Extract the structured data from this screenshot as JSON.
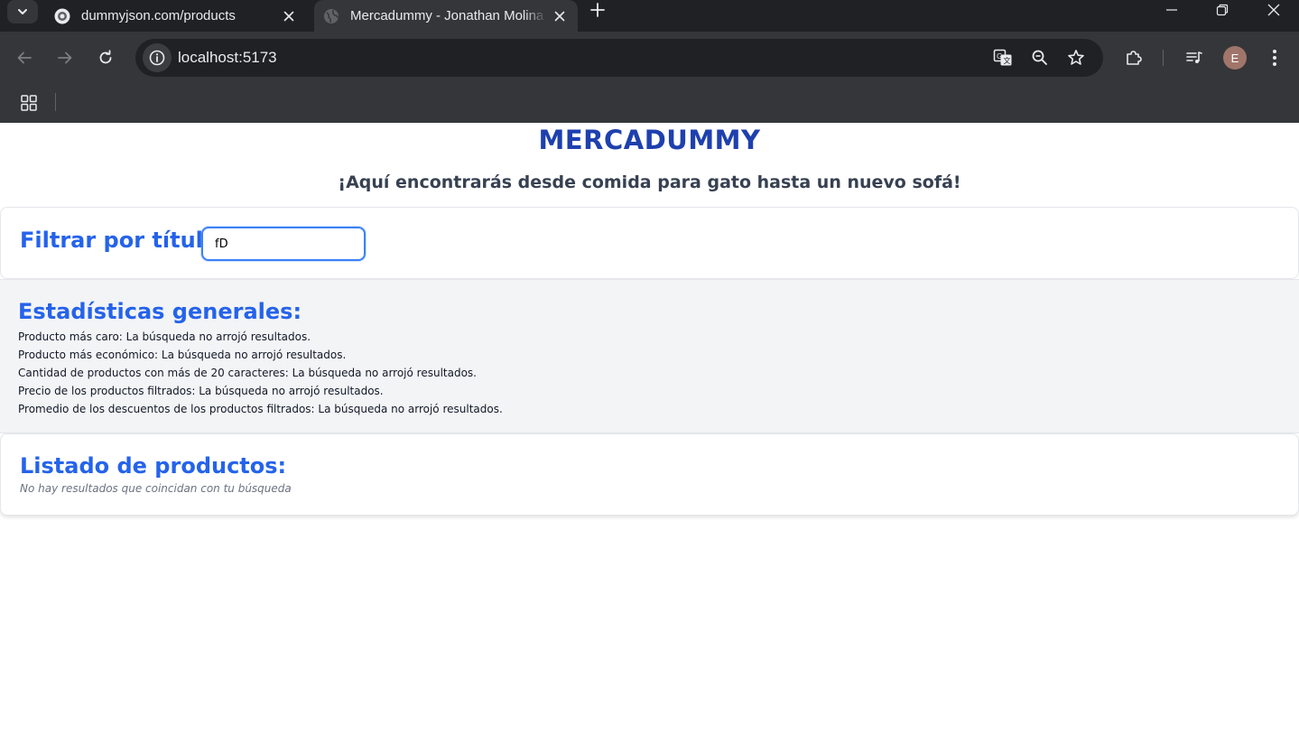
{
  "browser": {
    "tabs": [
      {
        "title": "dummyjson.com/products",
        "active": false,
        "favicon": "dummyjson-favicon-icon"
      },
      {
        "title": "Mercadummy - Jonathan Molina",
        "active": true,
        "favicon": "globe-icon"
      }
    ],
    "url": "localhost:5173",
    "profile_initial": "E",
    "colors": {
      "chrome_dark": "#202124",
      "chrome": "#35363a",
      "avatar": "#a1756a"
    }
  },
  "page": {
    "title": "MERCADUMMY",
    "subtitle": "¡Aquí encontrarás desde comida para gato hasta un nuevo sofá!",
    "filter": {
      "label": "Filtrar por título:",
      "value": "fD"
    },
    "stats": {
      "heading": "Estadísticas generales:",
      "items": [
        "Producto más caro: La búsqueda no arrojó resultados.",
        "Producto más económico: La búsqueda no arrojó resultados.",
        "Cantidad de productos con más de 20 caracteres: La búsqueda no arrojó resultados.",
        "Precio de los productos filtrados: La búsqueda no arrojó resultados.",
        "Promedio de los descuentos de los productos filtrados: La búsqueda no arrojó resultados."
      ]
    },
    "products": {
      "heading": "Listado de productos:",
      "empty_message": "No hay resultados que coincidan con tu búsqueda"
    },
    "colors": {
      "title": "#1e40af",
      "heading": "#2563eb",
      "input_border": "#3b82f6",
      "stats_bg": "#f3f4f6"
    }
  }
}
